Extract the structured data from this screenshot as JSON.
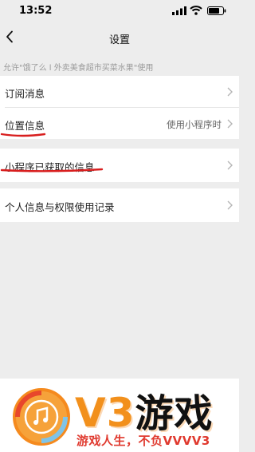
{
  "status_bar": {
    "time": "13:52"
  },
  "nav": {
    "title": "设置"
  },
  "allow_text": "允许\"饿了么 l 外卖美食超市买菜水果\"使用",
  "settings": {
    "subscribe_label": "订阅消息",
    "location_label": "位置信息",
    "location_value": "使用小程序时",
    "obtained_info_label": "小程序已获取的信息",
    "personal_info_label": "个人信息与权限使用记录"
  },
  "banner": {
    "brand_v3": "V3",
    "brand_cn": "游戏",
    "slogan": "游戏人生，不负VVVV3"
  },
  "colors": {
    "annotation_red": "#d81e1e",
    "brand_orange": "#f47a1a",
    "slogan_red": "#e03a2f"
  }
}
